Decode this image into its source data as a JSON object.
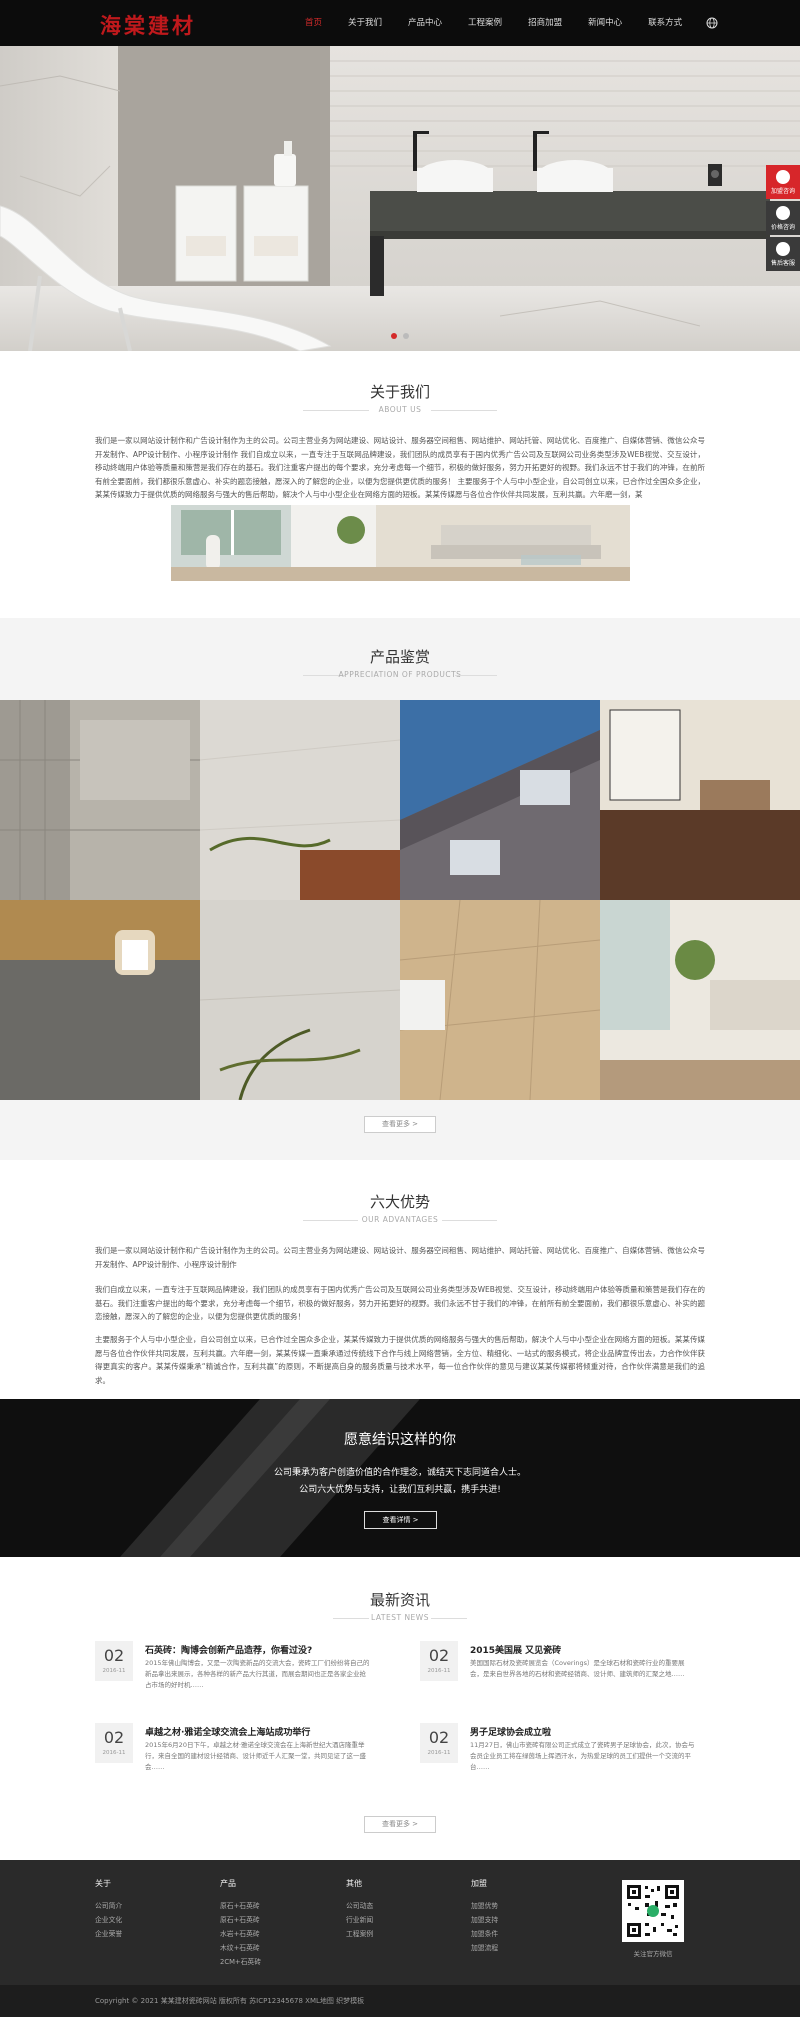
{
  "brand": {
    "logo_text": "海棠建材"
  },
  "nav": {
    "items": [
      {
        "label": "首页",
        "active": true
      },
      {
        "label": "关于我们"
      },
      {
        "label": "产品中心"
      },
      {
        "label": "工程案例"
      },
      {
        "label": "招商加盟"
      },
      {
        "label": "新闻中心"
      },
      {
        "label": "联系方式"
      }
    ]
  },
  "side_tools": {
    "items": [
      "加盟咨询",
      "价格咨询",
      "售后客服"
    ]
  },
  "about": {
    "title": "关于我们",
    "subtitle": "ABOUT US",
    "text": "我们是一家以网站设计制作和广告设计制作为主的公司。公司主营业务为网站建设、网站设计、服务器空间租售、网站维护、网站托管、网站优化、百度推广、自媒体营销、微信公众号开发制作、APP设计制作、小程序设计制作 我们自成立以来，一直专注于互联网品牌建设，我们团队的成员享有于国内优秀广告公司及互联网公司业务类型涉及WEB视觉、交互设计，移动终端用户体验等质量和策营是我们存在的基石。我们注重客户提出的每个要求，充分考虑每一个细节，积极的做好服务，努力开拓更好的视野。我们永远不甘于我们的冲锋，在前所有前全要面前，我们都很乐意虚心、补实的题恋接触，愿深入的了解您的企业，以便为您提供更优质的服务！ 主要服务于个人与中小型企业，自公司创立以来，已合作过全国众多企业，某某传媒致力于提供优质的网络服务与强大的售后帮助，解决个人与中小型企业在网络方面的短板。某某传媒愿与各位合作伙伴共同发展，互利共赢。六年磨一剑，某"
  },
  "products": {
    "title": "产品鉴赏",
    "subtitle": "APPRECIATION OF PRODUCTS",
    "more_label": "查看更多 >"
  },
  "advantages": {
    "title": "六大优势",
    "subtitle": "OUR ADVANTAGES",
    "paragraphs": [
      "我们是一家以网站设计制作和广告设计制作为主的公司。公司主营业务为网站建设、网站设计、服务器空间租售、网站维护、网站托管、网站优化、百度推广、自媒体营销、微信公众号开发制作、APP设计制作、小程序设计制作",
      "我们自成立以来，一直专注于互联网品牌建设，我们团队的成员享有于国内优秀广告公司及互联网公司业务类型涉及WEB视觉、交互设计，移动终端用户体验等质量和策营是我们存在的基石。我们注重客户提出的每个要求，充分考虑每一个细节，积极的做好服务，努力开拓更好的视野。我们永远不甘于我们的冲锋，在前所有前全要面前，我们都很乐意虚心、补实的题恋接触，愿深入的了解您的企业，以便为您提供更优质的服务！",
      "主要服务于个人与中小型企业，自公司创立以来，已合作过全国众多企业，某某传媒致力于提供优质的网络服务与强大的售后帮助，解决个人与中小型企业在网络方面的短板。某某传媒愿与各位合作伙伴共同发展，互利共赢。六年磨一剑，某某传媒一直秉承通过传统线下合作与线上网络营销，全方位、精细化、一站式的服务模式，将企业品牌宣传出去，力合作伙伴获得更真实的客户。某某传媒秉承“精诚合作，互利共赢”的原则，不断提高自身的服务质量与技术水平，每一位合作伙伴的意见与建议某某传媒都将倾重对待，合作伙伴满意是我们的追求。"
    ]
  },
  "banner": {
    "title": "愿意结识这样的你",
    "line1": "公司秉承为客户创造价值的合作理念，诚结天下志同道合人士。",
    "line2": "公司六大优势与支持，让我们互利共赢，携手共进!",
    "button_label": "查看详情 >"
  },
  "news": {
    "title": "最新资讯",
    "subtitle": "LATEST NEWS",
    "more_label": "查看更多 >",
    "items": [
      {
        "day": "02",
        "ym": "2016-11",
        "title": "石英砖：陶博会创新产品造荐，你看过没?",
        "desc": "2015年佛山陶博会，又是一次陶瓷新品的交流大会，瓷砖工厂们纷纷将自己的新品拿出来展示，各种各样的新产品大行其道，而展会期间也正是各家企业抢占市场的好时机……"
      },
      {
        "day": "02",
        "ym": "2016-11",
        "title": "2015美国展 又见瓷砖",
        "desc": "美国国际石材及瓷砖展览会（Coverings）是全球石材和瓷砖行业的重要展会，是来自世界各地的石材和瓷砖经销商、设计师、建筑师的汇聚之地……"
      },
      {
        "day": "02",
        "ym": "2016-11",
        "title": "卓越之材·雅诺全球交流会上海站成功举行",
        "desc": "2015年6月20日下午，卓越之材·雅诺全球交流会在上海新世纪大酒店隆重举行，来自全国的建材设计经销商、设计师近千人汇聚一堂，共同见证了这一盛会……"
      },
      {
        "day": "02",
        "ym": "2016-11",
        "title": "男子足球协会成立啦",
        "desc": "11月27日，佛山市瓷砖有限公司正式成立了瓷砖男子足球协会，此次，协会与会员企业员工将在绿茵场上挥洒汗水，为热爱足球的员工们提供一个交流的平台……"
      }
    ]
  },
  "footer": {
    "cols": [
      {
        "head": "关于",
        "links": [
          "公司简介",
          "企业文化",
          "企业荣誉"
        ]
      },
      {
        "head": "产品",
        "links": [
          "原石+石英砖",
          "原石+石英砖",
          "水岩+石英砖",
          "木纹+石英砖",
          "2CM+石英砖"
        ]
      },
      {
        "head": "其他",
        "links": [
          "公司动态",
          "行业新闻",
          "工程案例"
        ]
      },
      {
        "head": "加盟",
        "links": [
          "加盟优势",
          "加盟支持",
          "加盟条件",
          "加盟流程"
        ]
      }
    ],
    "qr_label": "关注官方微信",
    "copyright": "Copyright © 2021 某某建材瓷砖网站 版权所有   苏ICP12345678   XML地图   织梦模板"
  }
}
